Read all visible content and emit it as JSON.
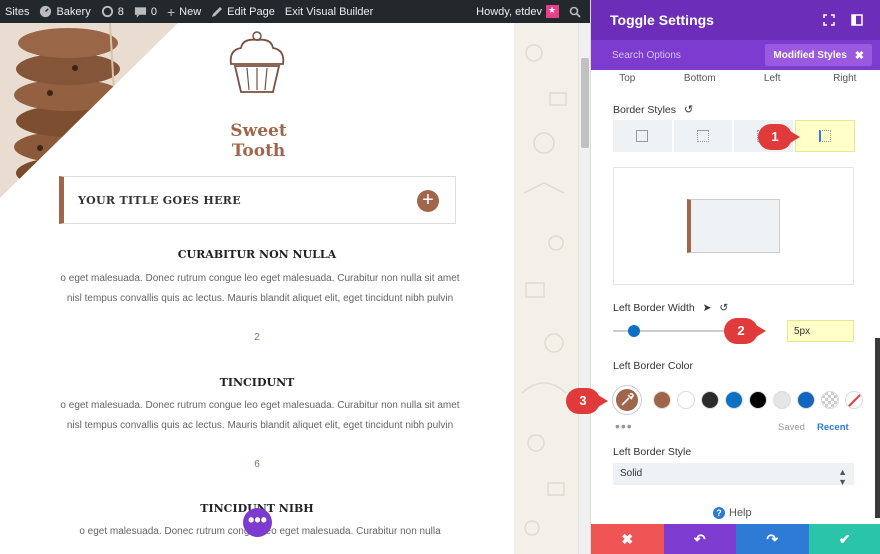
{
  "admin_bar": {
    "sites": "Sites",
    "site_name": "Bakery",
    "updates_count": "8",
    "comments_count": "0",
    "new_label": "New",
    "edit_page": "Edit Page",
    "exit_builder": "Exit Visual Builder",
    "howdy": "Howdy, etdev"
  },
  "page": {
    "brand": "Sweet Tooth",
    "toggle_title": "YOUR TITLE GOES HERE",
    "sections": [
      {
        "heading": "CURABITUR NON NULLA",
        "body": "o eget malesuada. Donec rutrum congue leo eget malesuada. Curabitur non nulla sit amet nisl tempus convallis quis ac lectus. Mauris blandit aliquet elit, eget tincidunt nibh pulvin",
        "number": "2"
      },
      {
        "heading": "TINCIDUNT",
        "body": "o eget malesuada. Donec rutrum congue leo eget malesuada. Curabitur non nulla sit amet nisl tempus convallis quis ac lectus. Mauris blandit aliquet elit, eget tincidunt nibh pulvin",
        "number": "6"
      },
      {
        "heading": "TINCIDUNT NIBH",
        "body": "o eget malesuada. Donec rutrum congue leo eget malesuada. Curabitur non nulla",
        "number": ""
      }
    ],
    "fab_label": "•••"
  },
  "panel": {
    "title": "Toggle Settings",
    "search_placeholder": "Search Options",
    "modified_styles": "Modified Styles",
    "side_tabs": [
      "Top",
      "Bottom",
      "Left",
      "Right"
    ],
    "border_styles_label": "Border Styles",
    "left_border_width_label": "Left Border Width",
    "left_border_width_value": "5px",
    "left_border_color_label": "Left Border Color",
    "saved": "Saved",
    "recent": "Recent",
    "left_border_style_label": "Left Border Style",
    "left_border_style_value": "Solid",
    "help": "Help"
  },
  "colors": {
    "accent_brown": "#a0664c",
    "builder_purple": "#6c2eb9",
    "swatches": [
      "#a0664c",
      "#ffffff",
      "#2b2b2b",
      "#0c71c3",
      "#000000",
      "#e5e5e5",
      "#1066c0",
      "checker",
      "none"
    ]
  },
  "callouts": [
    "1",
    "2",
    "3"
  ]
}
